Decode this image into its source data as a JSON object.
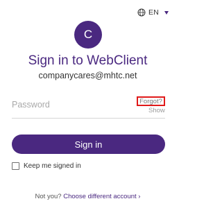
{
  "language": {
    "code": "EN",
    "icon": "globe-icon"
  },
  "account": {
    "avatar_initial": "C",
    "title": "Sign in to WebClient",
    "email": "companycares@mhtc.net"
  },
  "password_field": {
    "placeholder": "Password",
    "value": "",
    "forgot_label": "Forgot?",
    "show_label": "Show"
  },
  "sign_in_button": {
    "label": "Sign in"
  },
  "keep_signed_in": {
    "label": "Keep me signed in",
    "checked": false
  },
  "footer": {
    "prefix": "Not you?",
    "link_label": "Choose different account",
    "link_arrow": "›"
  },
  "colors": {
    "brand": "#4a2880",
    "highlight_box": "#e01919"
  }
}
